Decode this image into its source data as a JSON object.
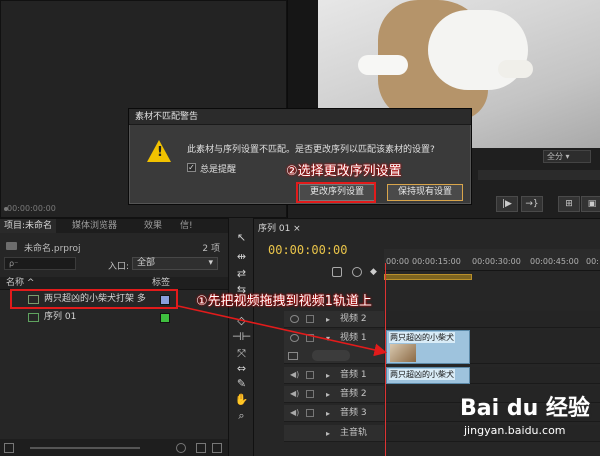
{
  "source_monitor": {
    "timecode": "00:00:00:00"
  },
  "program_monitor": {
    "zoom": "全分",
    "controls": [
      "|▶",
      "→}",
      "⊞",
      "▣"
    ]
  },
  "project_panel": {
    "tabs": [
      "项目:未命名",
      "媒体浏览器",
      "效果",
      "信!"
    ],
    "file": "未命名.prproj",
    "count": "2 项",
    "search_placeholder": "ρ⁻",
    "in_label": "入口:",
    "in_value": "全部",
    "col_name": "名称",
    "col_label": "标签",
    "items": [
      {
        "name": "两只超凶的小柴犬打架 多",
        "color": "#8a9edb"
      },
      {
        "name": "序列 01",
        "color": "#3fbf3f"
      }
    ]
  },
  "tools": [
    "↖",
    "⇹",
    "⇄",
    "⇆",
    "◇",
    "⊣⊢",
    "⤧",
    "⇔",
    "✎",
    "✋",
    "⌕"
  ],
  "timeline": {
    "tab": "序列 01 ×",
    "timecode": "00:00:00:00",
    "ruler": [
      "00:00",
      "00:00:15:00",
      "00:00:30:00",
      "00:00:45:00",
      "00:"
    ],
    "tracks": [
      {
        "name": "视频 2",
        "kind": "video"
      },
      {
        "name": "视频 1",
        "kind": "video"
      },
      {
        "name": "音频 1",
        "kind": "audio"
      },
      {
        "name": "音频 2",
        "kind": "audio"
      },
      {
        "name": "音频 3",
        "kind": "audio"
      },
      {
        "name": "主音轨",
        "kind": "master"
      }
    ],
    "clip_label": "两只超凶的小柴犬"
  },
  "dialog": {
    "title": "素材不匹配警告",
    "message": "此素材与序列设置不匹配。是否更改序列以匹配该素材的设置?",
    "checkbox_label": "总是提醒",
    "checkbox_mark": "✓",
    "btn_change": "更改序列设置",
    "btn_keep": "保持现有设置"
  },
  "annotations": {
    "step1": "①先把视频拖拽到视频1轨道上",
    "step2": "②选择更改序列设置",
    "color": "#e21b1b"
  },
  "watermark": {
    "logo": "Bai du 经验",
    "url": "jingyan.baidu.com"
  }
}
